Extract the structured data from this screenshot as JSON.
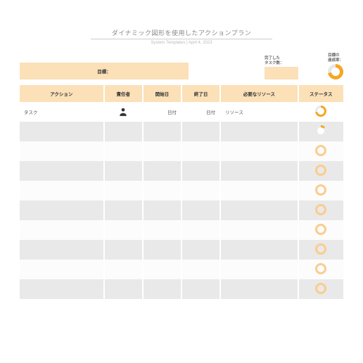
{
  "title": "ダイナミック図形を使用したアクションプラン",
  "subtitle": "System Templates | April 4, 2023",
  "topbar": {
    "goal_label": "目標：",
    "completed_label": "完了した\nタスク数：",
    "achievement_label": "目標の\n達成率："
  },
  "headers": {
    "action": "アクション",
    "person": "責任者",
    "start": "開始日",
    "end": "終了日",
    "resource": "必要なリソース",
    "status": "ステータス"
  },
  "rows": [
    {
      "action": "タスク",
      "start": "日付",
      "end": "日付",
      "resource": "リソース",
      "status": "partial",
      "has_person": true
    },
    {
      "action": "",
      "start": "",
      "end": "",
      "resource": "",
      "status": "tiny",
      "has_person": false
    },
    {
      "action": "",
      "start": "",
      "end": "",
      "resource": "",
      "status": "empty",
      "has_person": false
    },
    {
      "action": "",
      "start": "",
      "end": "",
      "resource": "",
      "status": "empty",
      "has_person": false
    },
    {
      "action": "",
      "start": "",
      "end": "",
      "resource": "",
      "status": "empty",
      "has_person": false
    },
    {
      "action": "",
      "start": "",
      "end": "",
      "resource": "",
      "status": "empty",
      "has_person": false
    },
    {
      "action": "",
      "start": "",
      "end": "",
      "resource": "",
      "status": "empty",
      "has_person": false
    },
    {
      "action": "",
      "start": "",
      "end": "",
      "resource": "",
      "status": "empty",
      "has_person": false
    },
    {
      "action": "",
      "start": "",
      "end": "",
      "resource": "",
      "status": "empty",
      "has_person": false
    },
    {
      "action": "",
      "start": "",
      "end": "",
      "resource": "",
      "status": "empty",
      "has_person": false
    }
  ]
}
